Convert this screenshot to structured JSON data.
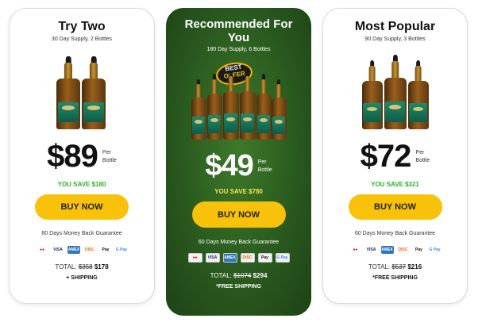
{
  "cards": [
    {
      "title": "Try Two",
      "supply": "30 Day Supply, 2 Bottles",
      "price": "$89",
      "per": "Per",
      "bottle": "Bottle",
      "save": "YOU SAVE $180",
      "button": "BUY NOW",
      "guarantee": "60 Days Money Back Guarantee",
      "total_label": "TOTAL:",
      "old_price": "$358",
      "new_price": "$178",
      "shipping": "+ SHIPPING"
    },
    {
      "title": "Recommended For You",
      "supply": "180 Day Supply, 6 Bottles",
      "badge_line1": "BEST",
      "badge_line2": "OFFER",
      "price": "$49",
      "per": "Per",
      "bottle": "Bottle",
      "save": "YOU SAVE $780",
      "button": "BUY NOW",
      "guarantee": "60 Days Money Back Guarantee",
      "total_label": "TOTAL:",
      "old_price": "$1074",
      "new_price": "$294",
      "shipping": "*FREE SHIPPING"
    },
    {
      "title": "Most Popular",
      "supply": "90 Day Supply, 3 Bottles",
      "price": "$72",
      "per": "Per",
      "bottle": "Bottle",
      "save": "YOU SAVE $321",
      "button": "BUY NOW",
      "guarantee": "60 Days Money Back Guarantee",
      "total_label": "TOTAL:",
      "old_price": "$537",
      "new_price": "$216",
      "shipping": "*FREE SHIPPING"
    }
  ],
  "payment_icons": [
    "mastercard-icon",
    "visa-icon",
    "amex-icon",
    "discover-icon",
    "apple-pay-icon",
    "google-pay-icon"
  ],
  "payment_labels": {
    "mastercard": "●●",
    "visa": "VISA",
    "amex": "AMEX",
    "discover": "DISC",
    "apple_pay": "Pay",
    "google_pay": "G Pay"
  },
  "colors": {
    "button": "#f8c10a",
    "save_green": "#2bb32b",
    "save_yellow": "#f7e34a",
    "card_mid_bg": "#2a5a1f"
  }
}
